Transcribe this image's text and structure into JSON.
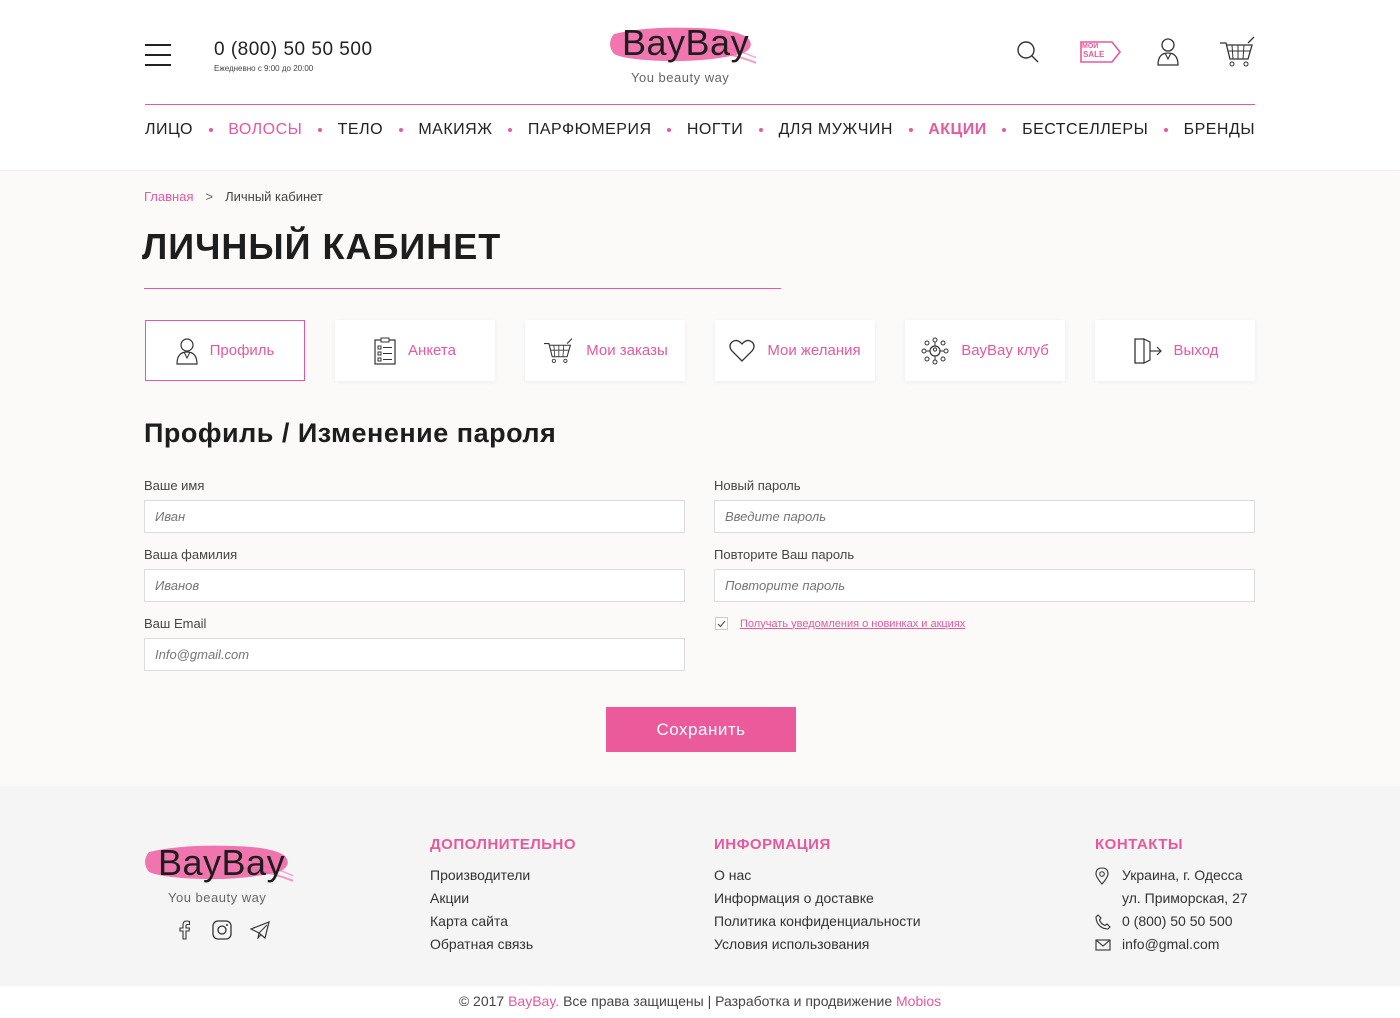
{
  "header": {
    "phone": "0 (800) 50 50 500",
    "hours": "Ежедневно с 9:00 до 20:00",
    "logo": {
      "brand": "BayBay",
      "tagline": "You beauty way"
    },
    "icons": [
      "menu-icon",
      "search-icon",
      "sale-tag-icon",
      "user-icon",
      "cart-icon"
    ],
    "sale_badge_top": "МОЙ",
    "sale_badge_bottom": "SALE"
  },
  "nav": {
    "items": [
      {
        "label": "ЛИЦО"
      },
      {
        "label": "ВОЛОСЫ"
      },
      {
        "label": "ТЕЛО"
      },
      {
        "label": "МАКИЯЖ"
      },
      {
        "label": "ПАРФЮМЕРИЯ"
      },
      {
        "label": "НОГТИ"
      },
      {
        "label": "ДЛЯ МУЖЧИН"
      },
      {
        "label": "АКЦИИ"
      },
      {
        "label": "БЕСТСЕЛЛЕРЫ"
      },
      {
        "label": "БРЕНДЫ"
      }
    ]
  },
  "breadcrumb": {
    "home": "Главная",
    "separator": ">",
    "current": "Личный кабинет"
  },
  "page_title": "ЛИЧНЫЙ КАБИНЕТ",
  "tabs": [
    {
      "label": "Профиль",
      "icon": "profile-icon"
    },
    {
      "label": "Анкета",
      "icon": "questionnaire-icon"
    },
    {
      "label": "Мои заказы",
      "icon": "cart-icon"
    },
    {
      "label": "Мои желания",
      "icon": "heart-icon"
    },
    {
      "label": "BayBay клуб",
      "icon": "club-icon"
    },
    {
      "label": "Выход",
      "icon": "logout-icon"
    }
  ],
  "section_title": "Профиль / Изменение пароля",
  "form": {
    "first_name": {
      "label": "Ваше имя",
      "placeholder": "Иван"
    },
    "last_name": {
      "label": "Ваша фамилия",
      "placeholder": "Иванов"
    },
    "email": {
      "label": "Ваш Email",
      "placeholder": "Info@gmail.com"
    },
    "new_password": {
      "label": "Новый пароль",
      "placeholder": "Введите пароль"
    },
    "repeat_password": {
      "label": "Повторите Ваш пароль",
      "placeholder": "Повторите пароль"
    },
    "subscribe": {
      "label": "Получать уведомления о новинках и акциях",
      "checked": true
    },
    "save_label": "Сохранить"
  },
  "footer": {
    "logo": {
      "brand": "BayBay",
      "tagline": "You beauty way"
    },
    "socials": [
      "facebook-icon",
      "instagram-icon",
      "telegram-icon"
    ],
    "col1": {
      "title": "ДОПОЛНИТЕЛЬНО",
      "links": [
        "Производители",
        "Акции",
        "Карта сайта",
        "Обратная связь"
      ]
    },
    "col2": {
      "title": "ИНФОРМАЦИЯ",
      "links": [
        "О нас",
        "Информация о доставке",
        "Политика конфиденциальности",
        "Условия использования"
      ]
    },
    "contacts": {
      "title": "КОНТАКТЫ",
      "address1": "Украина, г. Одесса",
      "address2": "ул. Приморская, 27",
      "phone": "0 (800) 50 50 500",
      "email": "info@gmal.com"
    },
    "copyright": {
      "prefix": "© 2017",
      "brand": "BayBay.",
      "middle": "Все права защищены | Разработка и продвижение",
      "dev": "Mobios"
    }
  },
  "colors": {
    "accent": "#e7589c",
    "button": "#eb5a9b",
    "background": "#fcfaf8",
    "footer_bg": "#f5f5f5"
  }
}
